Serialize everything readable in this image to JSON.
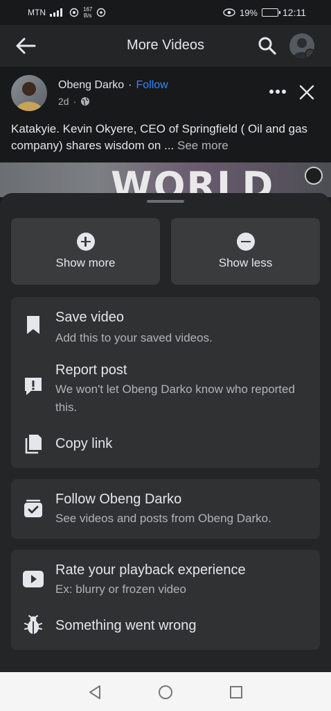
{
  "status_bar": {
    "carrier": "MTN",
    "network_speed": "167",
    "network_speed_unit": "B/s",
    "battery": "19%",
    "time": "12:11"
  },
  "app_bar": {
    "title": "More Videos",
    "back_icon": "arrow-left-icon",
    "search_icon": "search-icon"
  },
  "post": {
    "author": "Obeng Darko",
    "separator": "·",
    "follow_label": "Follow",
    "time_ago": "2d",
    "meta_separator": "·",
    "caption": "Katakyie. Kevin Okyere, CEO of  Springfield ( Oil and gas company) shares wisdom on ... ",
    "see_more": "See more",
    "more_icon": "more-dots-icon",
    "close_icon": "close-icon",
    "video_text": "WORLD"
  },
  "sheet": {
    "show_more": "Show more",
    "show_less": "Show less",
    "group1": [
      {
        "title": "Save video",
        "subtitle": "Add this to your saved videos.",
        "icon": "bookmark-icon"
      },
      {
        "title": "Report post",
        "subtitle": "We won't let Obeng Darko know who reported this.",
        "icon": "report-icon"
      },
      {
        "title": "Copy link",
        "subtitle": "",
        "icon": "copy-icon"
      }
    ],
    "group2": [
      {
        "title": "Follow Obeng Darko",
        "subtitle": "See videos and posts from Obeng Darko.",
        "icon": "follow-feed-icon"
      }
    ],
    "group3": [
      {
        "title": "Rate your playback experience",
        "subtitle": "Ex: blurry or frozen video",
        "icon": "video-play-icon"
      },
      {
        "title": "Something went wrong",
        "subtitle": "",
        "icon": "bug-icon"
      }
    ]
  },
  "colors": {
    "background": "#18191a",
    "sheet": "#242526",
    "card": "#303132",
    "accent": "#2d88ff",
    "text": "#e4e6eb",
    "secondary_text": "#b0b3b8"
  }
}
